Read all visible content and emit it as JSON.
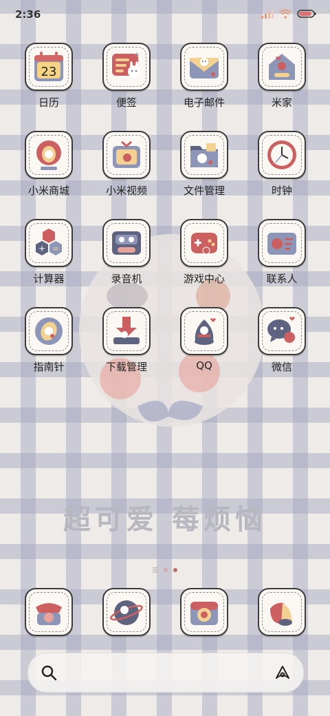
{
  "status": {
    "time": "2:36"
  },
  "grid_apps": [
    {
      "name": "日历",
      "icon": "calendar-icon",
      "day": "23"
    },
    {
      "name": "便签",
      "icon": "notes-icon"
    },
    {
      "name": "电子邮件",
      "icon": "email-icon"
    },
    {
      "name": "米家",
      "icon": "home-icon"
    },
    {
      "name": "小米商城",
      "icon": "store-icon"
    },
    {
      "name": "小米视频",
      "icon": "tv-icon"
    },
    {
      "name": "文件管理",
      "icon": "folder-icon"
    },
    {
      "name": "时钟",
      "icon": "clock-icon"
    },
    {
      "name": "计算器",
      "icon": "calculator-icon"
    },
    {
      "name": "录音机",
      "icon": "recorder-icon"
    },
    {
      "name": "游戏中心",
      "icon": "gamepad-icon"
    },
    {
      "name": "联系人",
      "icon": "contacts-icon"
    },
    {
      "name": "指南针",
      "icon": "compass-icon"
    },
    {
      "name": "下载管理",
      "icon": "download-icon"
    },
    {
      "name": "QQ",
      "icon": "qq-icon"
    },
    {
      "name": "微信",
      "icon": "wechat-icon"
    }
  ],
  "slogan": "超可爱 莓烦恼",
  "dock_apps": [
    {
      "icon": "phone-icon"
    },
    {
      "icon": "browser-icon"
    },
    {
      "icon": "camera-icon"
    },
    {
      "icon": "message-icon"
    }
  ]
}
